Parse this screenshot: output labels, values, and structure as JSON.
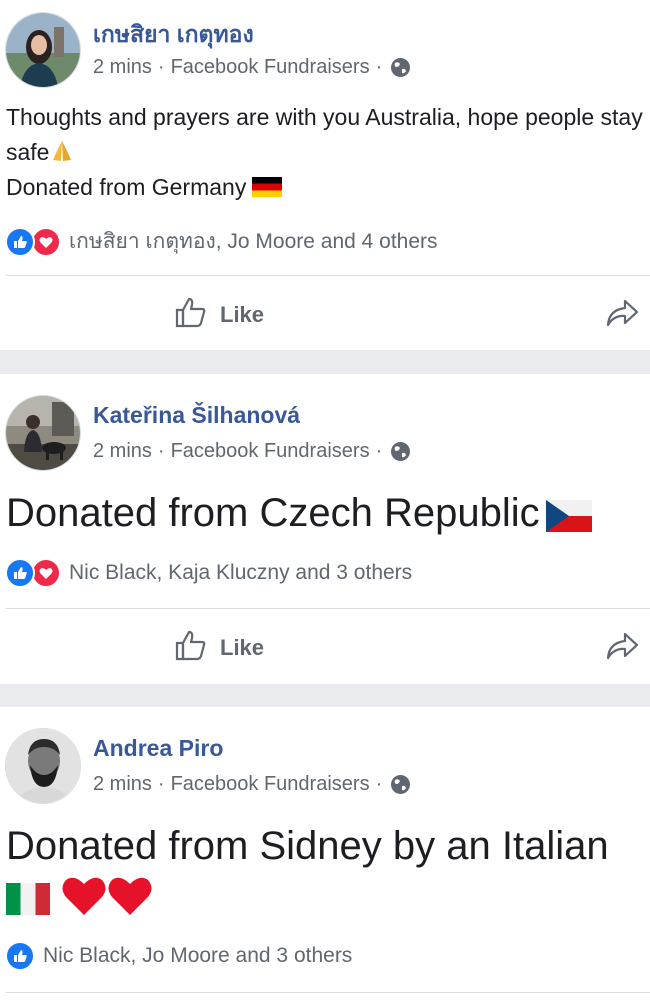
{
  "posts": [
    {
      "author": "เกษสิยา เกตุทอง",
      "time": "2 mins",
      "source": "Facebook Fundraisers",
      "separator": "·",
      "lines": [
        "Thoughts and prayers are with you Australia, hope people stay",
        "safe"
      ],
      "line3": "Donated from Germany",
      "reactions": "เกษสิยา เกตุทอง, Jo Moore and 4 others",
      "like_label": "Like"
    },
    {
      "author": "Kateřina Šilhanová",
      "time": "2 mins",
      "source": "Facebook Fundraisers",
      "separator": "·",
      "text": "Donated from Czech Republic",
      "reactions": "Nic Black, Kaja Kluczny and 3 others",
      "like_label": "Like"
    },
    {
      "author": "Andrea Piro",
      "time": "2 mins",
      "source": "Facebook Fundraisers",
      "separator": "·",
      "text": "Donated from Sidney by an Italian",
      "reactions": "Nic Black, Jo Moore and 3 others"
    }
  ],
  "icons": {
    "globe": "globe-icon",
    "like_reaction": "like-reaction-icon",
    "love_reaction": "love-reaction-icon",
    "thumbs_up": "thumbs-up-icon",
    "share": "share-icon",
    "praying_hands": "praying-hands-emoji",
    "germany_flag": "germany-flag-emoji",
    "czech_flag": "czech-flag-emoji",
    "italy_flag": "italy-flag-emoji",
    "heart": "red-heart-emoji"
  },
  "colors": {
    "author": "#385898",
    "meta": "#606770",
    "like_blue": "#1877f2",
    "love_red": "#f0284a",
    "background": "#e9ebee"
  }
}
